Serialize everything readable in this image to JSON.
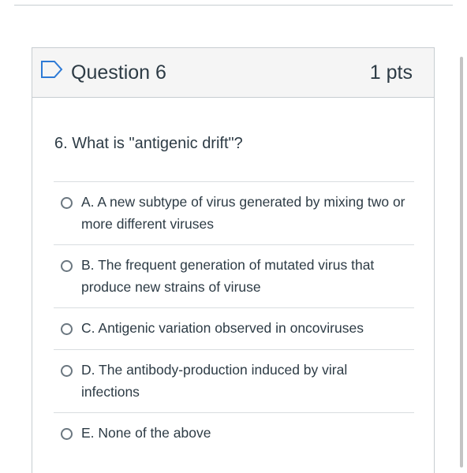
{
  "question": {
    "title": "Question 6",
    "points": "1 pts",
    "text": "6. What is \"antigenic drift\"?",
    "flag_icon": "flag-outline-icon"
  },
  "answers": [
    {
      "text": "A. A new subtype of virus generated by mixing two or more different viruses",
      "selected": false
    },
    {
      "text": "B. The frequent generation of mutated virus that produce new strains of viruse",
      "selected": false
    },
    {
      "text": "C. Antigenic variation observed in oncoviruses",
      "selected": false
    },
    {
      "text": "D. The antibody-production induced by viral infections",
      "selected": false
    },
    {
      "text": "E. None of the above",
      "selected": false
    }
  ],
  "colors": {
    "text": "#2d3b45",
    "border": "#c7cdd1",
    "header_bg": "#f5f5f5",
    "flag": "#2d7ad6"
  }
}
